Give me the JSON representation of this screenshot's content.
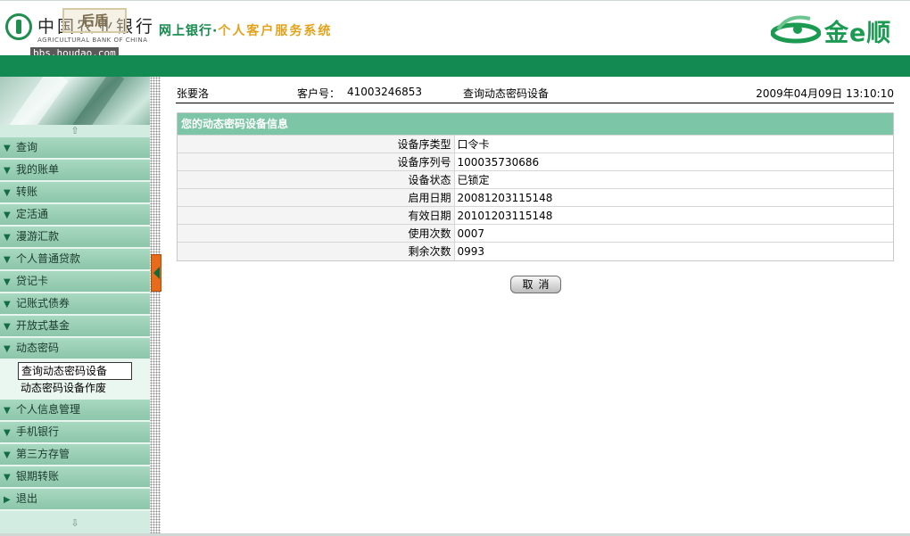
{
  "header": {
    "bank_name_cn": "中国农业银行",
    "bank_name_en": "AGRICULTURAL BANK OF CHINA",
    "watermark_text": "后盾",
    "watermark_url": "bbs.houdao.com",
    "system_title_prefix": "网上银行·",
    "system_title_main": "个人客户服务系统",
    "brand_text": "金e顺"
  },
  "sidebar": {
    "scroll_up_icon": "arrow-up-icon",
    "scroll_down_icon": "arrow-down-icon",
    "menu": [
      {
        "label": "查询"
      },
      {
        "label": "我的账单"
      },
      {
        "label": "转账"
      },
      {
        "label": "定活通"
      },
      {
        "label": "漫游汇款"
      },
      {
        "label": "个人普通贷款"
      },
      {
        "label": "贷记卡"
      },
      {
        "label": "记账式债券"
      },
      {
        "label": "开放式基金"
      },
      {
        "label": "动态密码"
      }
    ],
    "submenu": [
      {
        "label": "查询动态密码设备",
        "active": true
      },
      {
        "label": "动态密码设备作废",
        "active": false
      }
    ],
    "menu_after": [
      {
        "label": "个人信息管理"
      },
      {
        "label": "手机银行"
      },
      {
        "label": "第三方存管"
      },
      {
        "label": "银期转账"
      },
      {
        "label": "退出"
      }
    ]
  },
  "info_bar": {
    "user_name": "张要洛",
    "cust_label": "客户号：",
    "cust_number": "41003246853",
    "page_heading": "查询动态密码设备",
    "datetime": "2009年04月09日 13:10:10"
  },
  "panel": {
    "title": "您的动态密码设备信息",
    "rows": [
      {
        "label": "设备序类型",
        "value": "口令卡"
      },
      {
        "label": "设备序列号",
        "value": "100035730686"
      },
      {
        "label": "设备状态",
        "value": "已锁定"
      },
      {
        "label": "启用日期",
        "value": "20081203115148"
      },
      {
        "label": "有效日期",
        "value": "20101203115148"
      },
      {
        "label": "使用次数",
        "value": "0007"
      },
      {
        "label": "剩余次数",
        "value": "0993"
      }
    ]
  },
  "actions": {
    "cancel_label": "取消"
  },
  "colors": {
    "brand_green": "#128a52",
    "title_orange": "#e4a21a",
    "menu_green": "#8cc6aa",
    "panel_header": "#7cc5a6",
    "handle_orange": "#e86a1b"
  }
}
